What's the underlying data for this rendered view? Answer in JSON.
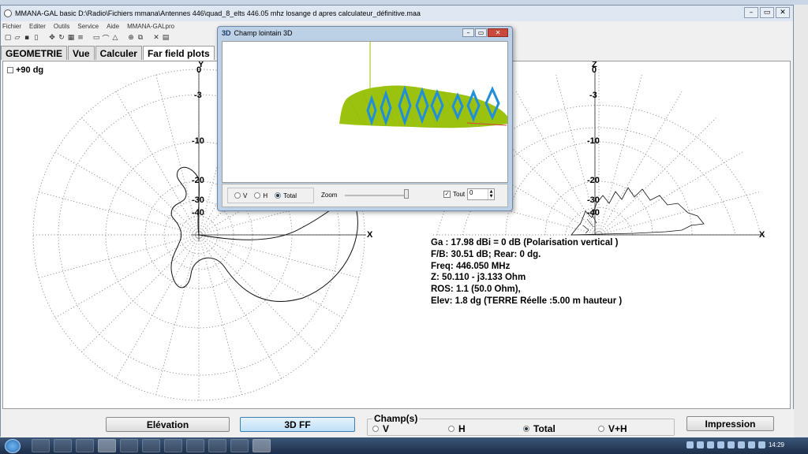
{
  "window": {
    "title": "MMANA-GAL basic D:\\Radio\\Fichiers mmana\\Antennes 446\\quad_8_elts 446.05 mhz losange d apres calculateur_définitive.maa"
  },
  "menu": [
    "Fichier",
    "Editer",
    "Outils",
    "Service",
    "Aide",
    "MMANA-GALpro"
  ],
  "toolbar_icons": [
    "new-icon",
    "open-icon",
    "save-icon",
    "copy-icon",
    "move-icon",
    "rotate-icon",
    "table-icon",
    "elements-icon",
    "page-icon",
    "curve-icon",
    "triangle-icon",
    "target-icon",
    "copy2-icon",
    "tools-icon",
    "calc-icon"
  ],
  "tabs": [
    "GEOMETRIE",
    "Vue",
    "Calculer",
    "Far field plots"
  ],
  "plot": {
    "checkbox_label": "+90 dg",
    "left_axis_label": "Y",
    "left_axis_x": "X",
    "right_axis_label": "Z",
    "right_axis_x": "X",
    "db_labels": [
      "0",
      "-3",
      "-10",
      "-20",
      "-30",
      "-40"
    ]
  },
  "info": {
    "line1": "Ga : 17.98 dBi = 0 dB  (Polarisation vertical )",
    "line2": "F/B: 30.51 dB; Rear: 0 dg.",
    "line3": "Freq: 446.050 MHz",
    "line4": "Z: 50.110 - j3.133 Ohm",
    "line5": "ROS: 1.1 (50.0 Ohm),",
    "line6": "Elev: 1.8 dg (TERRE Réelle   :5.00 m hauteur )"
  },
  "bottom": {
    "elevation": "Elévation",
    "ff3d": "3D FF",
    "group_title": "Champ(s)",
    "radio_v": "V",
    "radio_h": "H",
    "radio_total": "Total",
    "radio_vh": "V+H",
    "print": "Impression"
  },
  "dialog": {
    "tag": "3D",
    "title": "Champ lointain 3D",
    "radio_v": "V",
    "radio_h": "H",
    "radio_total": "Total",
    "zoom": "Zoom",
    "tout": "Tout",
    "spin_value": "0"
  },
  "taskbar": {
    "clock": "14:29"
  },
  "colors": {
    "pattern_green": "#9bc20e",
    "element_blue": "#1f8fdc",
    "grid": "#8c8c8c"
  }
}
